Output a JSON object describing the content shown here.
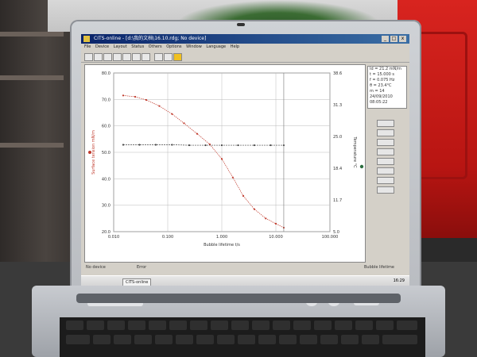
{
  "window": {
    "title": "CITS-online - [d:\\我的文档\\16.10.rdg; No device]",
    "controls": [
      "_",
      "□",
      "x"
    ]
  },
  "menu": [
    "File",
    "Device",
    "Layout",
    "Status",
    "Others",
    "Options",
    "Window",
    "Language",
    "Help"
  ],
  "readout": {
    "line1": "Id = 21.2 mN/m",
    "line2": "t = 15.000 s",
    "line3": "f = 0.075 Hz",
    "line4": "θ = 23.4°C",
    "line5": "m = 14",
    "line6": "24/09/2010 08:05:22"
  },
  "statusbar": {
    "left": "No device",
    "middle": "Error",
    "right": "Bubble lifetime"
  },
  "taskbar": {
    "item1": "CITS-online",
    "clock": "16:29"
  },
  "chart_data": {
    "type": "line",
    "xlabel": "Bubble lifetime t/s",
    "y1label": "Surface tension mN/m",
    "y2label": "Temperature °C",
    "x_scale": "log",
    "xlim": [
      0.01,
      100
    ],
    "ylim": [
      20,
      80
    ],
    "y2lim": [
      5,
      38.6
    ],
    "x_ticks": [
      "0.010",
      "0.100",
      "1.000",
      "10.000",
      "100.000"
    ],
    "y_ticks": [
      "20.0",
      "30.0",
      "40.0",
      "50.0",
      "60.0",
      "70.0",
      "80.0"
    ],
    "y2_ticks": [
      "5.0",
      "11.7",
      "18.4",
      "25.0",
      "31.3",
      "38.6"
    ],
    "grid": true,
    "series": [
      {
        "role": "surface-tension",
        "color": "#c0392b",
        "x": [
          0.015,
          0.025,
          0.04,
          0.07,
          0.12,
          0.2,
          0.35,
          0.6,
          1.0,
          1.6,
          2.5,
          4.0,
          6.5,
          10.0,
          14.0
        ],
        "y": [
          71.5,
          71.0,
          69.8,
          67.5,
          64.5,
          61.0,
          57.0,
          53.0,
          47.5,
          40.5,
          33.5,
          28.5,
          25.0,
          23.0,
          21.5
        ]
      },
      {
        "role": "temperature",
        "color": "#444444",
        "x": [
          0.015,
          0.03,
          0.06,
          0.12,
          0.25,
          0.5,
          1.0,
          2.0,
          4.0,
          8.0,
          14.0
        ],
        "y": [
          23.4,
          23.4,
          23.4,
          23.4,
          23.3,
          23.3,
          23.3,
          23.3,
          23.3,
          23.3,
          23.3
        ]
      }
    ]
  },
  "colors": {
    "titlebar": "#0a246a",
    "case_red": "#d8241f",
    "chart_red": "#c0392b"
  }
}
